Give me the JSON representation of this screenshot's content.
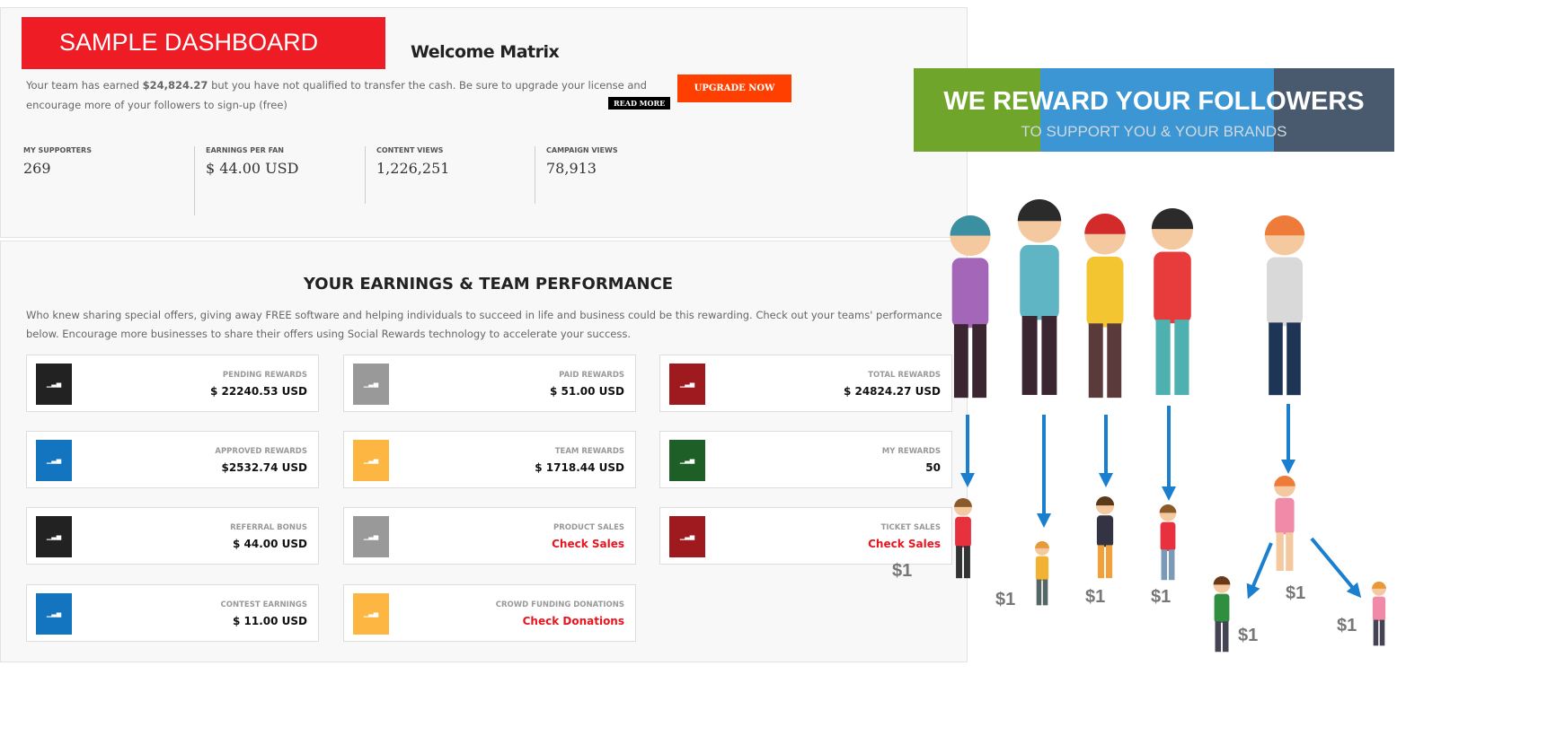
{
  "header": {
    "brand": "SAMPLE DASHBOARD",
    "welcome": "Welcome Matrix",
    "intro_prefix": "Your team has earned ",
    "intro_amount": "$24,824.27",
    "intro_suffix": " but you have not qualified to transfer the cash. Be sure to upgrade your license and encourage more of your followers to sign-up (free)",
    "read_more": "READ MORE",
    "upgrade": "UPGRADE NOW"
  },
  "stats": [
    {
      "label": "MY SUPPORTERS",
      "value": "269"
    },
    {
      "label": "EARNINGS PER FAN",
      "value": "$ 44.00 USD"
    },
    {
      "label": "CONTENT VIEWS",
      "value": "1,226,251"
    },
    {
      "label": "CAMPAIGN VIEWS",
      "value": "78,913"
    }
  ],
  "performance": {
    "title": "YOUR EARNINGS & TEAM PERFORMANCE",
    "description": "Who knew sharing special offers, giving away FREE software and helping individuals to succeed in life and business could be this rewarding. Check out your teams' performance below. Encourage more businesses to share their offers using Social Rewards technology to accelerate your success."
  },
  "cards": [
    {
      "label": "PENDING REWARDS",
      "value": "$ 22240.53 USD",
      "color": "#222222"
    },
    {
      "label": "PAID REWARDS",
      "value": "$ 51.00 USD",
      "color": "#999999"
    },
    {
      "label": "TOTAL REWARDS",
      "value": "$ 24824.27 USD",
      "color": "#9e1a1f"
    },
    {
      "label": "APPROVED REWARDS",
      "value": "$2532.74 USD",
      "color": "#1374c0"
    },
    {
      "label": "TEAM REWARDS",
      "value": "$ 1718.44 USD",
      "color": "#fdb642"
    },
    {
      "label": "MY REWARDS",
      "value": "50",
      "color": "#1e5e27"
    },
    {
      "label": "REFERRAL BONUS",
      "value": "$ 44.00 USD",
      "color": "#222222"
    },
    {
      "label": "PRODUCT SALES",
      "value": "Check Sales",
      "color": "#999999",
      "link": true
    },
    {
      "label": "TICKET SALES",
      "value": "Check Sales",
      "color": "#9e1a1f",
      "link": true
    },
    {
      "label": "CONTEST EARNINGS",
      "value": "$ 11.00 USD",
      "color": "#1374c0"
    },
    {
      "label": "CROWD FUNDING DONATIONS",
      "value": "Check Donations",
      "color": "#fdb642",
      "link": true
    }
  ],
  "promo": {
    "title": "WE REWARD YOUR FOLLOWERS",
    "subtitle": "TO SUPPORT YOU & YOUR BRANDS",
    "colors": [
      "#6fa52b",
      "#3b96d3",
      "#4a5a6e"
    ],
    "reward_label": "$1",
    "arrow_color": "#1a7fcf"
  }
}
